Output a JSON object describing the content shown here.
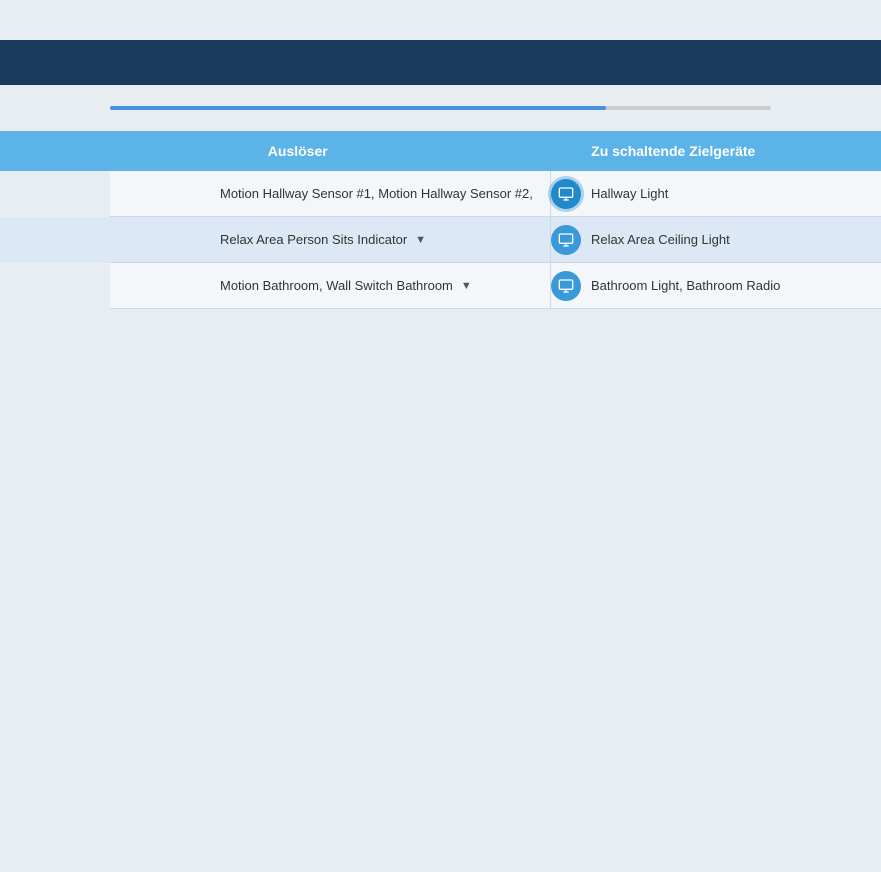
{
  "header": {
    "background_color": "#1a3a5c"
  },
  "columns": {
    "col1_label": "Auslöser",
    "col2_label": "Zu schaltende Zielgeräte"
  },
  "rows": [
    {
      "id": "row1",
      "trigger": "Motion Hallway Sensor #1, Motion Hallway Sensor #2,",
      "has_dropdown": false,
      "target_label": "Hallway Light",
      "highlighted": false
    },
    {
      "id": "row2",
      "trigger": "Relax Area Person Sits Indicator",
      "has_dropdown": true,
      "target_label": "Relax Area Ceiling Light",
      "highlighted": true
    },
    {
      "id": "row3",
      "trigger": "Motion Bathroom, Wall Switch Bathroom",
      "has_dropdown": true,
      "target_label": "Bathroom Light, Bathroom Radio",
      "highlighted": false
    }
  ],
  "icons": {
    "device_icon": "monitor-icon"
  }
}
